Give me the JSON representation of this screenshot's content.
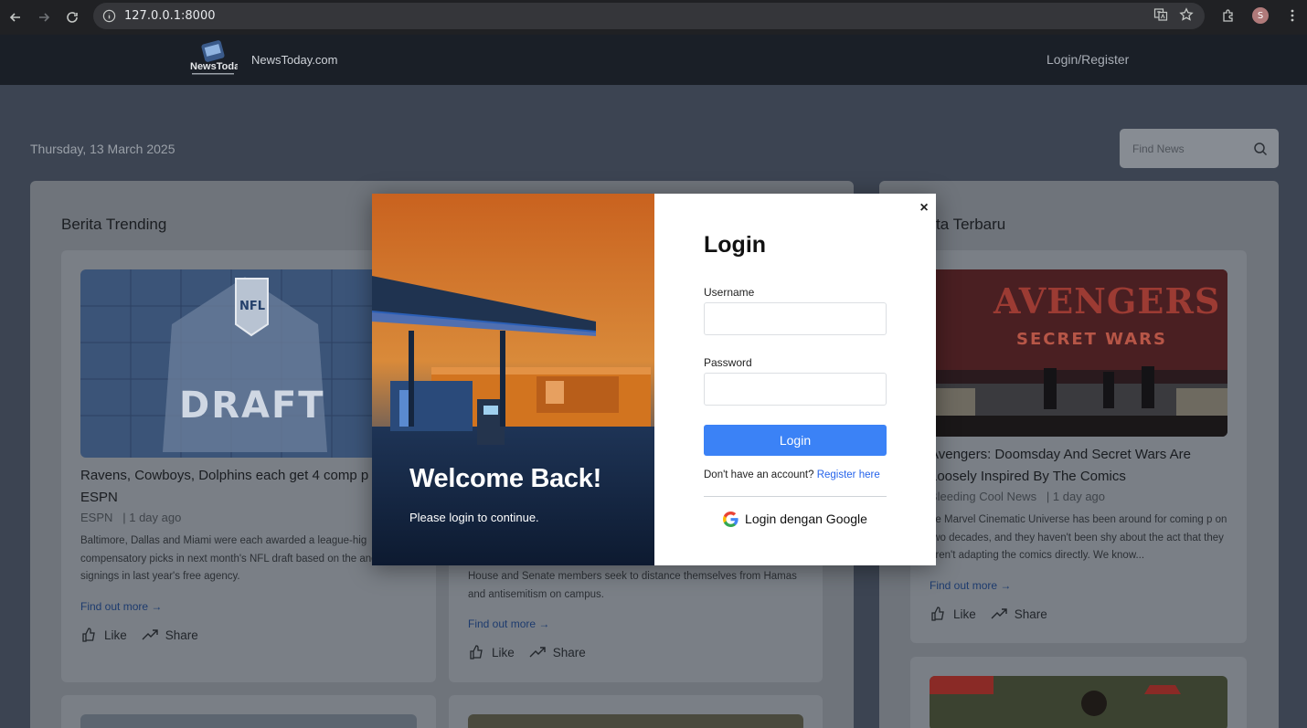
{
  "browser": {
    "url": "127.0.0.1:8000",
    "profile_initial": "S"
  },
  "header": {
    "site_name": "NewsToday.com",
    "login_link": "Login/Register",
    "logo_text": "NewsToday"
  },
  "page": {
    "date": "Thursday, 13 March 2025",
    "search_placeholder": "Find News"
  },
  "trending": {
    "title": "Berita Trending",
    "cards": [
      {
        "title": "Ravens, Cowboys, Dolphins each get 4 comp p",
        "title_line2": "ESPN",
        "source": "ESPN",
        "time": "| 1 day ago",
        "desc": "Baltimore, Dallas and Miami were each awarded a league-hig compensatory picks in next month's NFL draft based on the and signings in last year's free agency.",
        "more": "Find out more →",
        "like": "Like",
        "share": "Share"
      },
      {
        "desc": "House and Senate members seek to distance themselves from Hamas and antisemitism on campus.",
        "more": "Find out more →",
        "like": "Like",
        "share": "Share"
      }
    ]
  },
  "latest": {
    "title": "ta Terbaru",
    "cards": [
      {
        "title": "Avengers: Doomsday And Secret Wars Are Loosely Inspired By The Comics",
        "source": "Bleeding Cool News",
        "time": "| 1 day ago",
        "desc": "he Marvel Cinematic Universe has been around for coming p on two decades, and they haven't been shy about the act that they aren't adapting the comics directly. We know...",
        "more": "Find out more →",
        "like": "Like",
        "share": "Share"
      }
    ]
  },
  "modal": {
    "hero_title": "Welcome Back!",
    "hero_subtitle": "Please login to continue.",
    "close": "×",
    "title": "Login",
    "username_label": "Username",
    "username_value": "",
    "password_label": "Password",
    "password_value": "",
    "login_button": "Login",
    "register_prompt": "Don't have an account?",
    "register_link": "Register here",
    "google_button": "Login dengan Google"
  },
  "colors": {
    "accent": "#3b82f6",
    "link": "#2563eb",
    "header_bg": "#1a1f27"
  }
}
